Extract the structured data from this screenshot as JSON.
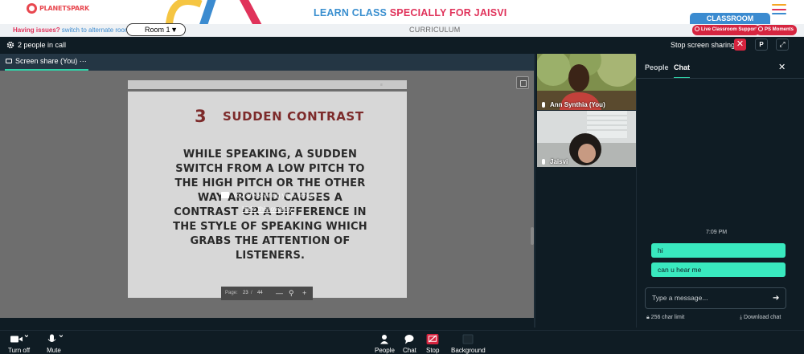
{
  "brand": {
    "logo_text": "PLANETSPARK"
  },
  "banner": {
    "title_prefix": "LEARN CLASS ",
    "title_emph": "SPECIALLY FOR JAISVI"
  },
  "classroom_tab": "CLASSROOM",
  "roombar": {
    "issue_q": "Having issues?",
    "issue_link": "switch to alternate room",
    "room_value": "Room 1",
    "curriculum": "CURRICULUM",
    "support_pill": "Live Classroom Support",
    "moments_pill": "PS Moments"
  },
  "meeting": {
    "people_count": "2 people in call",
    "stop_sharing": "Stop screen sharing",
    "stop_x": "✕",
    "p_button": "P",
    "expand": "⤢"
  },
  "share": {
    "tab_label": "Screen share (You)",
    "tab_more": "···",
    "overlay_title": "You are sharing your screen",
    "overlay_hide": "Hide this overlay"
  },
  "slide": {
    "number": "3",
    "title": "SUDDEN CONTRAST",
    "body": "WHILE SPEAKING, A SUDDEN SWITCH FROM A LOW PITCH TO THE HIGH PITCH OR THE OTHER WAY AROUND CAUSES A CONTRAST OR A DIFFERENCE IN THE STYLE OF SPEAKING WHICH GRABS THE ATTENTION OF LISTENERS.",
    "pager_label": "Page:",
    "page_current": "23",
    "page_sep": "/",
    "page_total": "44",
    "zoom_out": "—",
    "zoom_in": "+"
  },
  "participants": [
    {
      "name": "Ann Synthia (You)"
    },
    {
      "name": "Jaisvi"
    }
  ],
  "chat": {
    "tab_people": "People",
    "tab_chat": "Chat",
    "close": "✕",
    "time": "7:09 PM",
    "messages": [
      "hi",
      "can u hear me"
    ],
    "input_placeholder": "Type a message...",
    "send": "➔",
    "char_limit": "256 char limit",
    "download": "Download chat"
  },
  "toolbar": {
    "turn_off": "Turn off",
    "mute": "Mute",
    "people": "People",
    "chat": "Chat",
    "stop": "Stop",
    "background": "Background"
  },
  "colors": {
    "brand_red": "#e8474f",
    "title_blue": "#3a8fcf",
    "title_pink": "#e0325a",
    "accent_teal": "#2fd2a8",
    "bubble_green": "#39e9bf",
    "danger_red": "#d6243f",
    "meeting_bg": "#0f1c24"
  }
}
